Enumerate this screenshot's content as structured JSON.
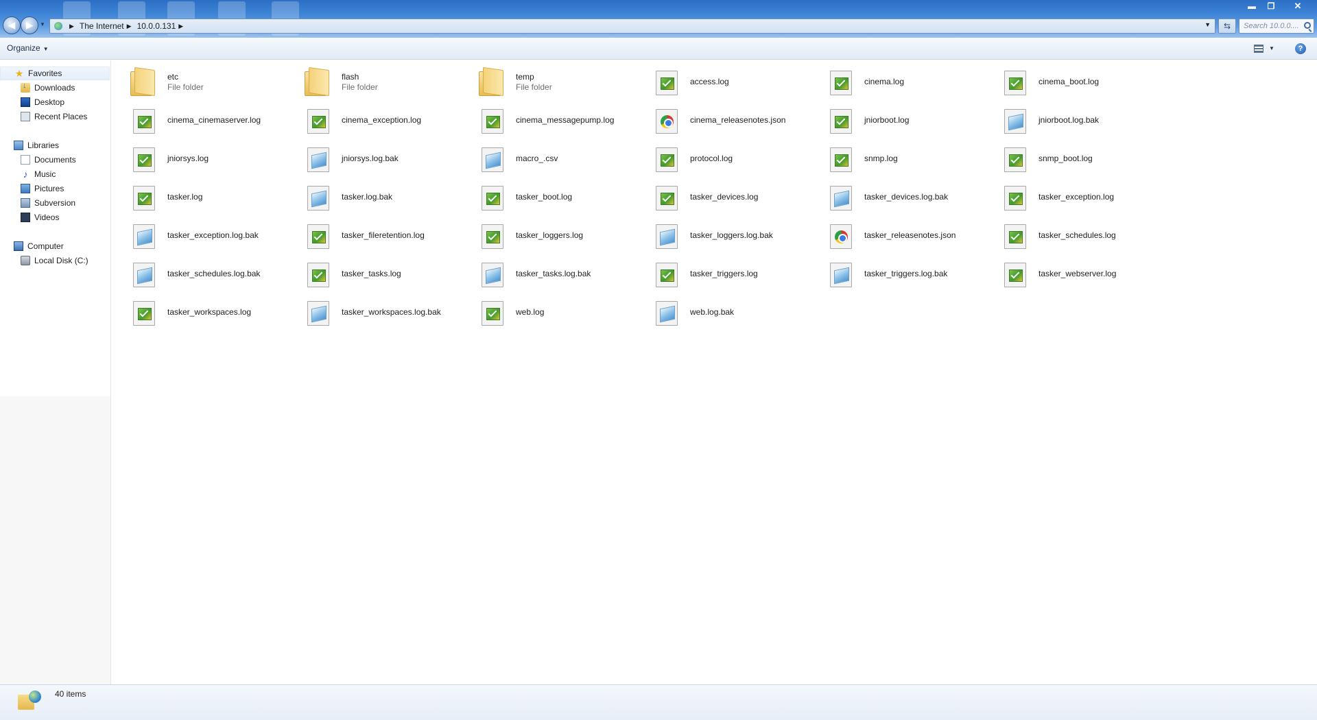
{
  "address": {
    "crumbs": [
      "The Internet",
      "10.0.0.131"
    ],
    "search_placeholder": "Search 10.0.0...."
  },
  "window_controls": {
    "minimize": "▬",
    "maximize": "❐",
    "close": "✕"
  },
  "command_bar": {
    "organize_label": "Organize"
  },
  "nav": {
    "favorites": "Favorites",
    "downloads": "Downloads",
    "desktop": "Desktop",
    "recent_places": "Recent Places",
    "libraries": "Libraries",
    "documents": "Documents",
    "music": "Music",
    "pictures": "Pictures",
    "subversion": "Subversion",
    "videos": "Videos",
    "computer": "Computer",
    "local_disk": "Local Disk (C:)"
  },
  "files": [
    {
      "name": "etc",
      "sub": "File folder",
      "kind": "folder"
    },
    {
      "name": "flash",
      "sub": "File folder",
      "kind": "folder"
    },
    {
      "name": "temp",
      "sub": "File folder",
      "kind": "folder"
    },
    {
      "name": "access.log",
      "kind": "log"
    },
    {
      "name": "cinema.log",
      "kind": "log"
    },
    {
      "name": "cinema_boot.log",
      "kind": "log"
    },
    {
      "name": "cinema_cinemaserver.log",
      "kind": "log"
    },
    {
      "name": "cinema_exception.log",
      "kind": "log"
    },
    {
      "name": "cinema_messagepump.log",
      "kind": "log"
    },
    {
      "name": "cinema_releasenotes.json",
      "kind": "json"
    },
    {
      "name": "jniorboot.log",
      "kind": "log"
    },
    {
      "name": "jniorboot.log.bak",
      "kind": "bak"
    },
    {
      "name": "jniorsys.log",
      "kind": "log"
    },
    {
      "name": "jniorsys.log.bak",
      "kind": "bak"
    },
    {
      "name": "macro_.csv",
      "kind": "bak"
    },
    {
      "name": "protocol.log",
      "kind": "log"
    },
    {
      "name": "snmp.log",
      "kind": "log"
    },
    {
      "name": "snmp_boot.log",
      "kind": "log"
    },
    {
      "name": "tasker.log",
      "kind": "log"
    },
    {
      "name": "tasker.log.bak",
      "kind": "bak"
    },
    {
      "name": "tasker_boot.log",
      "kind": "log"
    },
    {
      "name": "tasker_devices.log",
      "kind": "log"
    },
    {
      "name": "tasker_devices.log.bak",
      "kind": "bak"
    },
    {
      "name": "tasker_exception.log",
      "kind": "log"
    },
    {
      "name": "tasker_exception.log.bak",
      "kind": "bak"
    },
    {
      "name": "tasker_fileretention.log",
      "kind": "log"
    },
    {
      "name": "tasker_loggers.log",
      "kind": "log"
    },
    {
      "name": "tasker_loggers.log.bak",
      "kind": "bak"
    },
    {
      "name": "tasker_releasenotes.json",
      "kind": "json"
    },
    {
      "name": "tasker_schedules.log",
      "kind": "log"
    },
    {
      "name": "tasker_schedules.log.bak",
      "kind": "bak"
    },
    {
      "name": "tasker_tasks.log",
      "kind": "log"
    },
    {
      "name": "tasker_tasks.log.bak",
      "kind": "bak"
    },
    {
      "name": "tasker_triggers.log",
      "kind": "log"
    },
    {
      "name": "tasker_triggers.log.bak",
      "kind": "bak"
    },
    {
      "name": "tasker_webserver.log",
      "kind": "log"
    },
    {
      "name": "tasker_workspaces.log",
      "kind": "log"
    },
    {
      "name": "tasker_workspaces.log.bak",
      "kind": "bak"
    },
    {
      "name": "web.log",
      "kind": "log"
    },
    {
      "name": "web.log.bak",
      "kind": "bak"
    }
  ],
  "status": {
    "item_count": "40 items"
  }
}
